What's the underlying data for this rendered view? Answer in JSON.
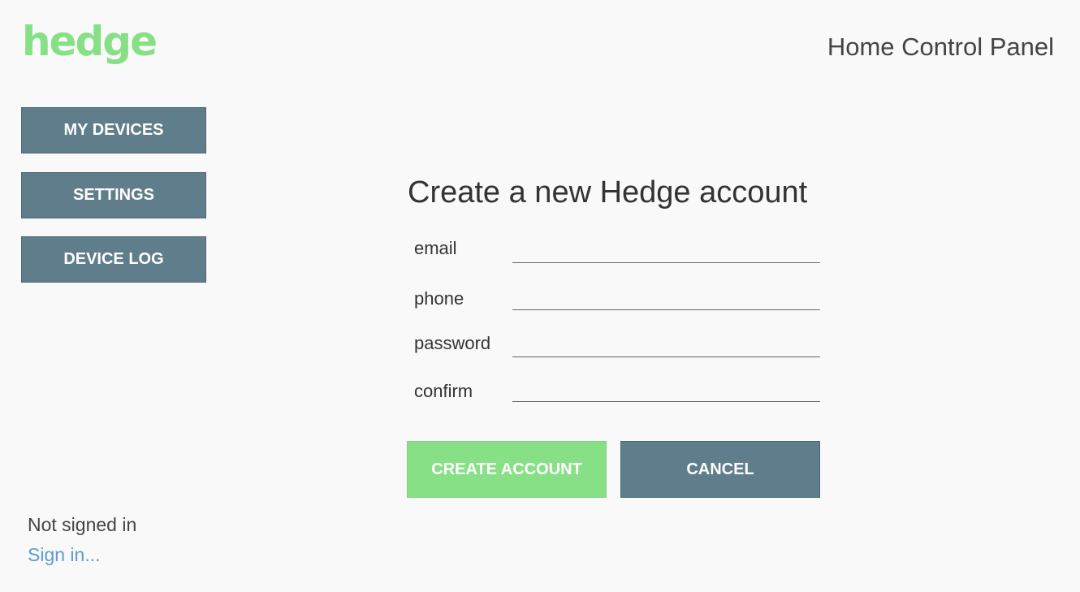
{
  "header": {
    "logo_text": "hedge",
    "title": "Home Control Panel"
  },
  "sidebar": {
    "items": [
      {
        "label": "MY DEVICES"
      },
      {
        "label": "SETTINGS"
      },
      {
        "label": "DEVICE LOG"
      }
    ],
    "status_text": "Not signed in",
    "sign_in_label": "Sign in..."
  },
  "form": {
    "title": "Create a new Hedge account",
    "fields": [
      {
        "label": "email",
        "value": ""
      },
      {
        "label": "phone",
        "value": ""
      },
      {
        "label": "password",
        "value": ""
      },
      {
        "label": "confirm",
        "value": ""
      }
    ],
    "create_label": "CREATE ACCOUNT",
    "cancel_label": "CANCEL"
  },
  "colors": {
    "brand_green": "#87e086",
    "slate_button": "#607d8b",
    "link_blue": "#5b9bd5",
    "background": "#f9f9f9"
  }
}
